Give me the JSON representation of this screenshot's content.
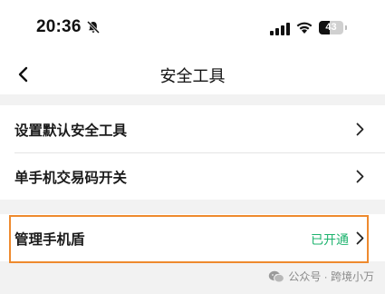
{
  "status_bar": {
    "time": "20:36",
    "battery_level": "43"
  },
  "nav": {
    "title": "安全工具"
  },
  "rows": [
    {
      "label": "设置默认安全工具"
    },
    {
      "label": "单手机交易码开关"
    },
    {
      "label": "管理手机盾",
      "status": "已开通"
    }
  ],
  "colors": {
    "accent_green": "#1db36e",
    "highlight_orange": "#ee8a2e",
    "background": "#f2f2f2"
  },
  "watermark": {
    "text": "公众号 · 跨境小万"
  }
}
